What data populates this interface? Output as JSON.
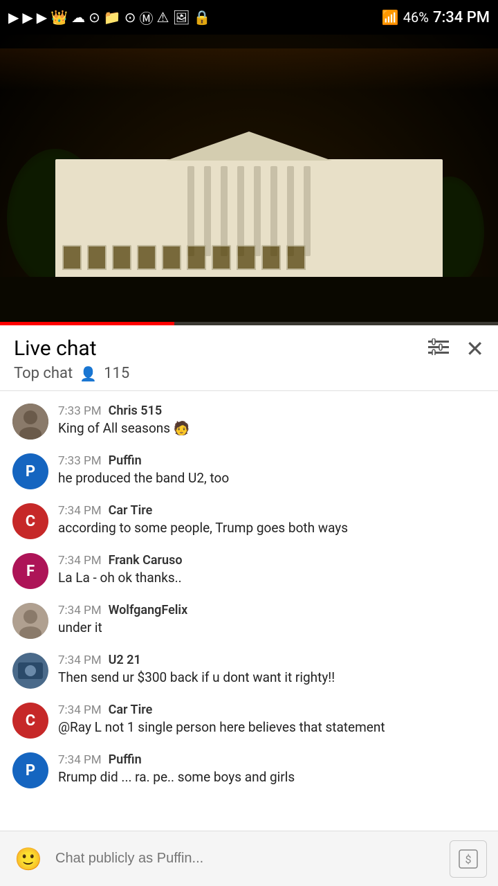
{
  "statusBar": {
    "time": "7:34 PM",
    "battery": "46%",
    "signal": "wifi"
  },
  "header": {
    "chatTitle": "Live chat",
    "chatSubtitle": "Top chat",
    "viewerCount": "115"
  },
  "messages": [
    {
      "id": 1,
      "avatarType": "photo1",
      "avatarLetter": "",
      "avatarColor": "photo1",
      "time": "7:33 PM",
      "name": "Chris 515",
      "text": "King of All seasons 🧑"
    },
    {
      "id": 2,
      "avatarType": "letter",
      "avatarLetter": "P",
      "avatarColor": "av-blue",
      "time": "7:33 PM",
      "name": "Puffin",
      "text": "he produced the band U2, too"
    },
    {
      "id": 3,
      "avatarType": "letter",
      "avatarLetter": "C",
      "avatarColor": "av-red",
      "time": "7:34 PM",
      "name": "Car Tire",
      "text": "according to some people, Trump goes both ways"
    },
    {
      "id": 4,
      "avatarType": "letter",
      "avatarLetter": "F",
      "avatarColor": "av-pink",
      "time": "7:34 PM",
      "name": "Frank Caruso",
      "text": "La La - oh ok thanks.."
    },
    {
      "id": 5,
      "avatarType": "photo2",
      "avatarLetter": "",
      "avatarColor": "photo2",
      "time": "7:34 PM",
      "name": "WolfgangFelix",
      "text": "under it"
    },
    {
      "id": 6,
      "avatarType": "photo3",
      "avatarLetter": "",
      "avatarColor": "photo3",
      "time": "7:34 PM",
      "name": "U2 21",
      "text": "Then send ur $300 back if u dont want it righty!!"
    },
    {
      "id": 7,
      "avatarType": "letter",
      "avatarLetter": "C",
      "avatarColor": "av-red",
      "time": "7:34 PM",
      "name": "Car Tire",
      "text": "@Ray L not 1 single person here believes that statement"
    },
    {
      "id": 8,
      "avatarType": "letter",
      "avatarLetter": "P",
      "avatarColor": "av-blue",
      "time": "7:34 PM",
      "name": "Puffin",
      "text": "Rrump did ... ra. pe.. some boys and girls"
    }
  ],
  "input": {
    "placeholder": "Chat publicly as Puffin..."
  },
  "controls": {
    "filterLabel": "filter",
    "closeLabel": "close",
    "emojiLabel": "emoji",
    "sendLabel": "send"
  }
}
